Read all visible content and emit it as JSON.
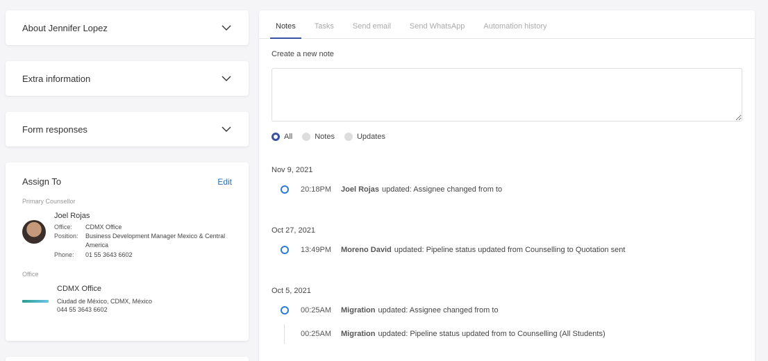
{
  "sidebar": {
    "accordions": [
      {
        "title": "About Jennifer Lopez"
      },
      {
        "title": "Extra information"
      },
      {
        "title": "Form responses"
      }
    ],
    "assign": {
      "title": "Assign To",
      "edit_label": "Edit",
      "primary_label": "Primary Counsellor",
      "person": {
        "name": "Joel Rojas",
        "office_key": "Office:",
        "office_val": "CDMX Office",
        "position_key": "Position:",
        "position_val": "Business Development Manager Mexico & Central America",
        "phone_key": "Phone:",
        "phone_val": "01 55 3643 6602"
      },
      "office_label": "Office",
      "office": {
        "name": "CDMX Office",
        "address": "Ciudad de México, CDMX, México",
        "phone": "044 55 3643 6602"
      }
    }
  },
  "main": {
    "tabs": [
      {
        "label": "Notes"
      },
      {
        "label": "Tasks"
      },
      {
        "label": "Send email"
      },
      {
        "label": "Send WhatsApp"
      },
      {
        "label": "Automation history"
      }
    ],
    "note_label": "Create a new note",
    "filters": [
      {
        "label": "All"
      },
      {
        "label": "Notes"
      },
      {
        "label": "Updates"
      }
    ],
    "timeline": [
      {
        "date": "Nov 9, 2021",
        "events": [
          {
            "time": "20:18PM",
            "actor": "Joel Rojas",
            "text": "updated: Assignee changed from to"
          }
        ]
      },
      {
        "date": "Oct 27, 2021",
        "events": [
          {
            "time": "13:49PM",
            "actor": "Moreno David",
            "text": "updated: Pipeline status updated from Counselling to Quotation sent"
          }
        ]
      },
      {
        "date": "Oct 5, 2021",
        "events": [
          {
            "time": "00:25AM",
            "actor": "Migration",
            "text": "updated: Assignee changed from to"
          },
          {
            "time": "00:25AM",
            "actor": "Migration",
            "text": "updated: Pipeline status updated from to Counselling (All Students)"
          }
        ]
      }
    ]
  },
  "colors": {
    "accent": "#3953a4",
    "dot": "#2b7bd6",
    "link": "#2b6cb0"
  }
}
